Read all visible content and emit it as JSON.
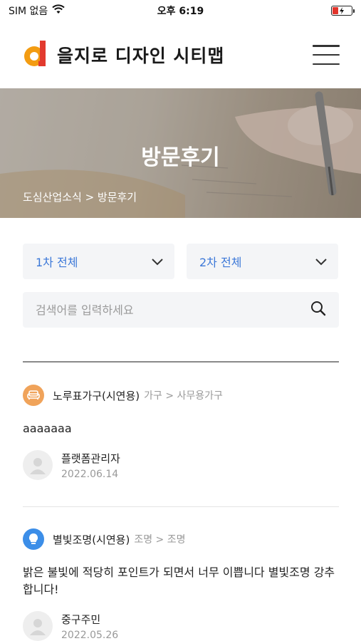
{
  "status": {
    "carrier": "SIM 없음",
    "time": "오후 6:19"
  },
  "header": {
    "title": "을지로 디자인 시티맵"
  },
  "hero": {
    "title": "방문후기",
    "breadcrumb": "도심산업소식 > 방문후기"
  },
  "filters": {
    "first": "1차 전체",
    "second": "2차 전체"
  },
  "search": {
    "placeholder": "검색어를 입력하세요"
  },
  "reviews": [
    {
      "product": "노루표가구(시연용)",
      "category": "가구 > 사무용가구",
      "icon": "sofa-icon",
      "icon_color": "#f0a35a",
      "body": "aaaaaaa",
      "author": "플랫폼관리자",
      "date": "2022.06.14"
    },
    {
      "product": "별빛조명(시연용)",
      "category": "조명 > 조명",
      "icon": "lightbulb-icon",
      "icon_color": "#3c8ee8",
      "body": "밝은 불빛에 적당히 포인트가 되면서 너무 이쁩니다 별빛조명 강추합니다!",
      "author": "중구주민",
      "date": "2022.05.26"
    }
  ],
  "colors": {
    "accent": "#3c78d8",
    "logo_orange": "#f39c12",
    "logo_red": "#e23a2e"
  }
}
